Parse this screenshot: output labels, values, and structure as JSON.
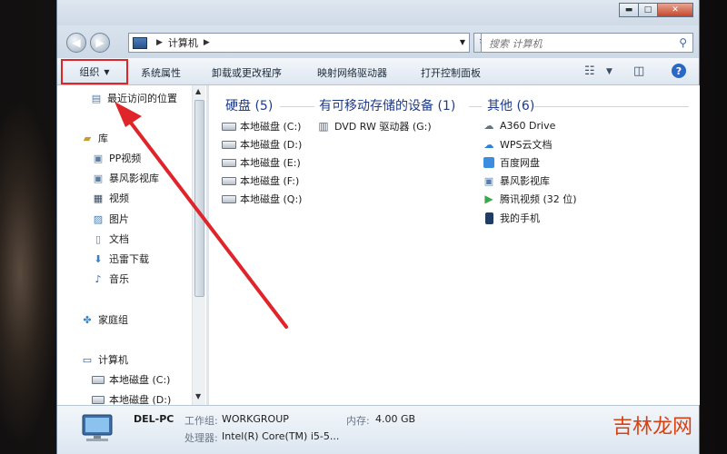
{
  "window": {
    "caption_minimize": "▬",
    "caption_maximize": "□",
    "caption_close": "✕"
  },
  "address": {
    "crumb": "计算机",
    "search_placeholder": "搜索 计算机"
  },
  "toolbar": {
    "organize": "组织",
    "system_properties": "系统属性",
    "uninstall": "卸载或更改程序",
    "map_drive": "映射网络驱动器",
    "control_panel": "打开控制面板",
    "help": "?"
  },
  "nav": {
    "items": [
      {
        "label": "最近访问的位置",
        "icon": "recent-places-icon"
      },
      {
        "label": "库",
        "icon": "library-icon"
      },
      {
        "label": "PP视频",
        "icon": "video-library-icon"
      },
      {
        "label": "暴风影视库",
        "icon": "video-library-icon"
      },
      {
        "label": "视频",
        "icon": "video-icon"
      },
      {
        "label": "图片",
        "icon": "picture-icon"
      },
      {
        "label": "文档",
        "icon": "document-icon"
      },
      {
        "label": "迅雷下载",
        "icon": "download-icon"
      },
      {
        "label": "音乐",
        "icon": "music-icon"
      },
      {
        "label": "家庭组",
        "icon": "homegroup-icon"
      },
      {
        "label": "计算机",
        "icon": "computer-icon"
      },
      {
        "label": "本地磁盘 (C:)",
        "icon": "drive-icon"
      },
      {
        "label": "本地磁盘 (D:)",
        "icon": "drive-icon"
      }
    ]
  },
  "groups": {
    "hdd": {
      "title": "硬盘 (5)",
      "items": [
        "本地磁盘 (C:)",
        "本地磁盘 (D:)",
        "本地磁盘 (E:)",
        "本地磁盘 (F:)",
        "本地磁盘 (Q:)"
      ]
    },
    "removable": {
      "title": "有可移动存储的设备 (1)",
      "items": [
        "DVD RW 驱动器 (G:)"
      ]
    },
    "other": {
      "title": "其他 (6)",
      "items": [
        "A360 Drive",
        "WPS云文档",
        "百度网盘",
        "暴风影视库",
        "腾讯视频 (32 位)",
        "我的手机"
      ]
    }
  },
  "details": {
    "name": "DEL-PC",
    "workgroup_label": "工作组:",
    "workgroup_value": "WORKGROUP",
    "memory_label": "内存:",
    "memory_value": "4.00 GB",
    "cpu_label": "处理器:",
    "cpu_value": "Intel(R) Core(TM) i5-5..."
  },
  "watermark": "吉林龙网",
  "colors": {
    "highlight_box": "#e0252a",
    "group_header": "#1e3b8a",
    "arrow": "#e0252a"
  }
}
